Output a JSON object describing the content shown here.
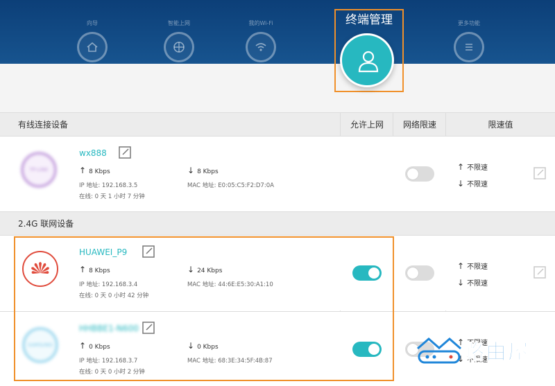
{
  "header": {
    "nav": [
      {
        "label": "向导"
      },
      {
        "label": "智能上网"
      },
      {
        "label": "我的Wi-Fi"
      },
      {
        "label": "终端管理"
      },
      {
        "label": "更多功能"
      }
    ],
    "active_label": "终端管理"
  },
  "table": {
    "headers": {
      "device": "有线连接设备",
      "allow": "允许上网",
      "limit": "网络限速",
      "speed": "限速值"
    },
    "wireless_section": "2.4G 联网设备",
    "wired_devices": [
      {
        "name": "wx888",
        "up": "8 Kbps",
        "down": "8 Kbps",
        "ip": "IP 地址: 192.168.3.5",
        "mac": "MAC 地址: E0:05:C5:F2:D7:0A",
        "online": "在线: 0 天 1 小时 7 分钟",
        "logo_text": "TP-LINK",
        "up_limit": "不限速",
        "down_limit": "不限速",
        "limit_enabled": false
      }
    ],
    "wireless_devices": [
      {
        "name": "HUAWEI_P9",
        "up": "8 Kbps",
        "down": "24 Kbps",
        "ip": "IP 地址: 192.168.3.4",
        "mac": "MAC 地址: 44:6E:E5:30:A1:10",
        "online": "在线: 0 天 0 小时 42 分钟",
        "allow": true,
        "limit_enabled": false,
        "up_limit": "不限速",
        "down_limit": "不限速"
      },
      {
        "name": "HHBBE1-N600",
        "up": "0 Kbps",
        "down": "0 Kbps",
        "ip": "IP 地址: 192.168.3.7",
        "mac": "MAC 地址: 68:3E:34:5F:4B:87",
        "online": "在线: 0 天 0 小时 2 分钟",
        "logo_text": "SAMSUNG",
        "allow": true,
        "limit_enabled": false,
        "up_limit": "不限速",
        "down_limit": "不限速"
      }
    ]
  },
  "watermark": {
    "text": "路由屋"
  },
  "colors": {
    "accent": "#27b8c0",
    "header": "#0f4680",
    "highlight": "#f0902a",
    "brand_red": "#e04b3c"
  }
}
